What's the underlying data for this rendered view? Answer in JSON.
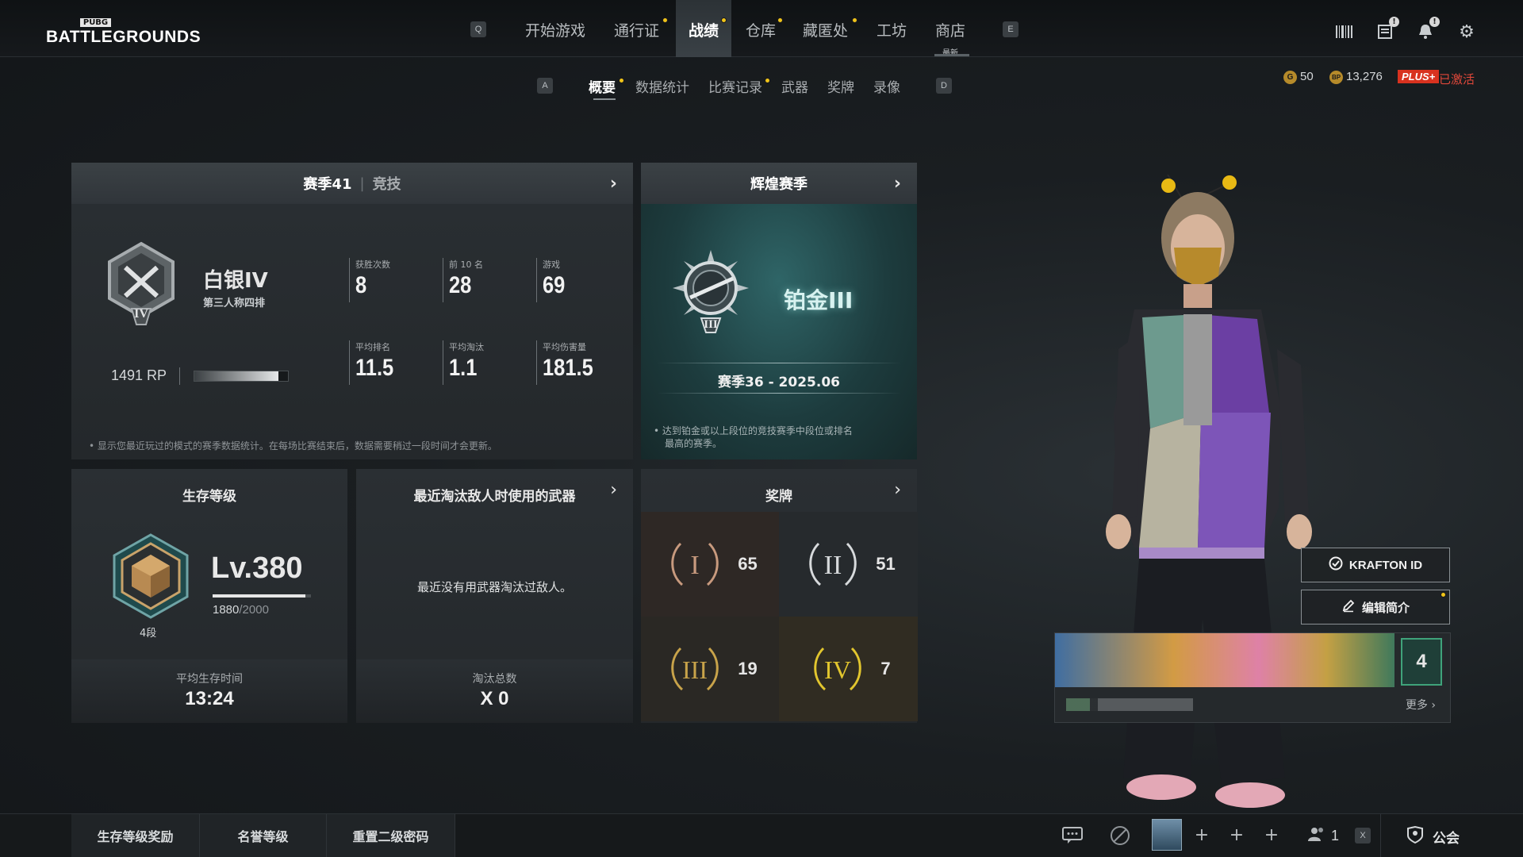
{
  "logo": {
    "small": "PUBG",
    "big": "BATTLEGROUNDS"
  },
  "topnav": {
    "key_left": "Q",
    "key_right": "E",
    "items": [
      "开始游戏",
      "通行证",
      "战绩",
      "仓库",
      "藏匿处",
      "工坊",
      "商店"
    ],
    "shop_tag": "最新"
  },
  "subnav": {
    "key_left": "A",
    "key_right": "D",
    "items": [
      "概要",
      "数据统计",
      "比赛记录",
      "武器",
      "奖牌",
      "录像"
    ]
  },
  "currency": {
    "g_icon": "G",
    "g_amount": "50",
    "bp_icon": "BP",
    "bp_amount": "13,276",
    "plus_label": "PLUS+",
    "plus_status": "已激活"
  },
  "season_panel": {
    "title_season": "赛季41",
    "title_mode": "竞技",
    "rank_name": "白银IV",
    "rank_mode": "第三人称四排",
    "rank_numeral": "IV",
    "rp": "1491 RP",
    "rp_progress": 0.9,
    "stats": [
      {
        "label": "获胜次数",
        "value": "8"
      },
      {
        "label": "前 10 名",
        "value": "28"
      },
      {
        "label": "游戏",
        "value": "69"
      },
      {
        "label": "平均排名",
        "value": "11.5"
      },
      {
        "label": "平均淘汰",
        "value": "1.1"
      },
      {
        "label": "平均伤害量",
        "value": "181.5"
      }
    ],
    "footnote": "显示您最近玩过的模式的赛季数据统计。在每场比赛结束后，数据需要稍过一段时间才会更新。"
  },
  "glory_panel": {
    "title": "辉煌赛季",
    "rank_name": "铂金III",
    "rank_numeral": "III",
    "season": "赛季36 - 2025.06",
    "footnote_l1": "达到铂金或以上段位的竞技赛季中段位或排名",
    "footnote_l2": "最高的赛季。"
  },
  "survival_panel": {
    "title": "生存等级",
    "level": "Lv.380",
    "xp_current": "1880",
    "xp_total": "/2000",
    "xp_progress": 0.94,
    "tier": "4段",
    "avg_survival_label": "平均生存时间",
    "avg_survival_value": "13:24"
  },
  "weapon_panel": {
    "title": "最近淘汰敌人时使用的武器",
    "empty_message": "最近没有用武器淘汰过敌人。",
    "kills_label": "淘汰总数",
    "kills_value": "X 0"
  },
  "medal_panel": {
    "title": "奖牌",
    "medals": [
      {
        "numeral": "I",
        "count": "65",
        "color": "#c89a7e"
      },
      {
        "numeral": "II",
        "count": "51",
        "color": "#d7dadc"
      },
      {
        "numeral": "III",
        "count": "19",
        "color": "#c8a34a"
      },
      {
        "numeral": "IV",
        "count": "7",
        "color": "#e2c62e"
      }
    ]
  },
  "character": {
    "krafton_button": "KRAFTON ID",
    "edit_button": "编辑简介",
    "banner_level": "4",
    "more_link": "更多 ›"
  },
  "bottombar": {
    "buttons": [
      "生存等级奖励",
      "名誉等级",
      "重置二级密码"
    ],
    "party_count": "1",
    "party_key": "X",
    "clan_label": "公会"
  }
}
